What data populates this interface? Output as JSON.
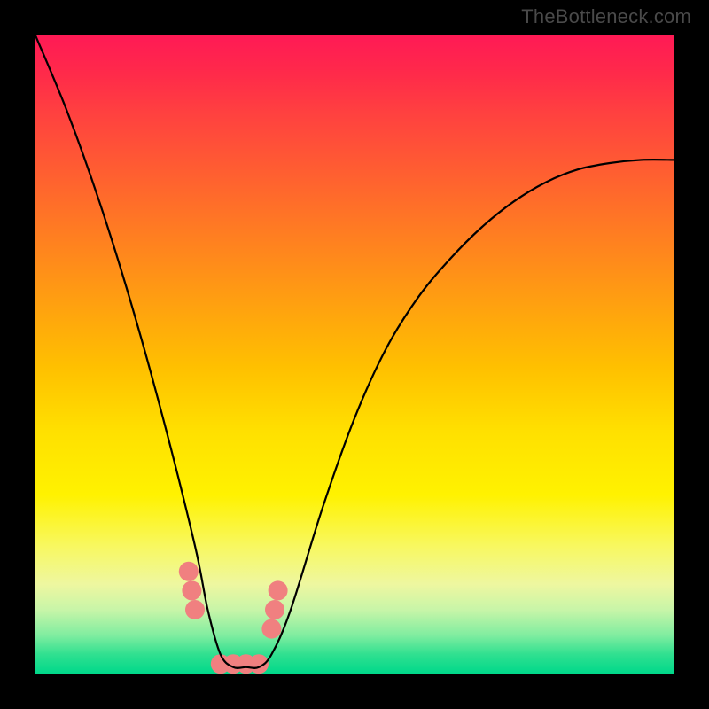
{
  "watermark": "TheBottleneck.com",
  "chart_data": {
    "type": "line",
    "title": "",
    "xlabel": "",
    "ylabel": "",
    "xlim": [
      0,
      100
    ],
    "ylim": [
      0,
      100
    ],
    "series": [
      {
        "name": "curve",
        "x": [
          0,
          5,
          10,
          15,
          20,
          25,
          27,
          29,
          31,
          33,
          35,
          37,
          40,
          45,
          50,
          55,
          60,
          65,
          70,
          75,
          80,
          85,
          90,
          95,
          100
        ],
        "values": [
          100,
          88,
          74,
          58,
          40,
          20,
          10,
          3,
          1,
          1,
          1,
          3,
          10,
          26,
          40,
          51,
          59,
          65,
          70,
          74,
          77,
          79,
          80,
          80.5,
          80.5
        ]
      }
    ],
    "markers": {
      "name": "dots",
      "x": [
        24,
        24.5,
        25,
        29,
        31,
        33,
        35,
        37,
        37.5,
        38
      ],
      "values": [
        16,
        13,
        10,
        1.5,
        1.5,
        1.5,
        1.5,
        7,
        10,
        13
      ],
      "color": "#f08080",
      "radius": 11
    },
    "background_gradient": {
      "top": "#ff1a55",
      "mid": "#ffe000",
      "bottom": "#00d88a"
    }
  }
}
